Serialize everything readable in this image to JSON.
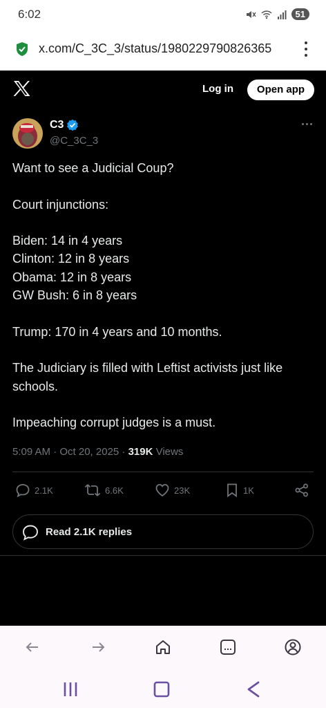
{
  "status_bar": {
    "time": "6:02",
    "battery": "51"
  },
  "url_bar": {
    "url": "x.com/C_3C_3/status/1980229790826365"
  },
  "header": {
    "login_label": "Log in",
    "open_app_label": "Open app"
  },
  "tweet": {
    "author_name": "C3",
    "author_handle": "@C_3C_3",
    "lines": [
      "Want to see a Judicial Coup?",
      "",
      "Court injunctions:",
      "",
      "Biden: 14 in 4 years",
      "Clinton: 12 in 8 years",
      "Obama: 12 in 8 years",
      "GW Bush: 6 in 8 years",
      "",
      "Trump: 170 in 4 years and 10 months.",
      "",
      "The Judiciary is filled with Leftist activists just like",
      "schools.",
      "",
      "Impeaching corrupt judges is a must."
    ],
    "timestamp": "5:09 AM · Oct 20, 2025 · ",
    "views_count": "319K",
    "views_label": " Views",
    "actions": {
      "replies": "2.1K",
      "reposts": "6.6K",
      "likes": "23K",
      "bookmarks": "1K"
    },
    "read_replies_label": "Read 2.1K replies"
  },
  "colors": {
    "verified": "#1d9bf0",
    "text": "#e7e9ea",
    "muted": "#71767b",
    "nav_icon": "#4a4458",
    "sys_icon": "#6b4fa0"
  },
  "icons": {
    "status": [
      "mute-icon",
      "wifi-icon",
      "signal-icon",
      "battery-icon"
    ],
    "url_bar": [
      "security-shield-icon",
      "overflow-menu-icon"
    ],
    "actions": [
      "reply-icon",
      "repost-icon",
      "like-icon",
      "bookmark-icon",
      "share-icon"
    ],
    "browser_nav": [
      "back-arrow-icon",
      "forward-arrow-icon",
      "home-icon",
      "tabs-icon",
      "account-icon"
    ],
    "system_nav": [
      "recents-icon",
      "home-button-icon",
      "back-icon"
    ]
  }
}
